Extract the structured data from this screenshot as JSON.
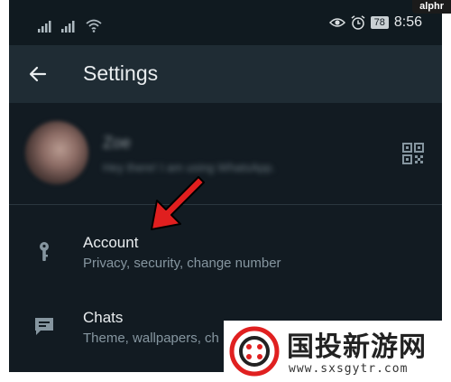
{
  "status_bar": {
    "time": "8:56",
    "battery": "78"
  },
  "app_bar": {
    "title": "Settings"
  },
  "profile": {
    "name": "Zoe",
    "status": "Hey there! I am using WhatsApp."
  },
  "settings_items": [
    {
      "label": "Account",
      "subtitle": "Privacy, security, change number",
      "icon": "key-icon"
    },
    {
      "label": "Chats",
      "subtitle": "Theme, wallpapers, ch",
      "icon": "chat-icon"
    }
  ],
  "watermarks": {
    "corner": "alphr",
    "site_name": "国投新游网",
    "site_url": "www.sxsgytr.com"
  },
  "colors": {
    "background": "#121b22",
    "app_bar": "#1f2c34",
    "arrow": "#e01f1f",
    "text_primary": "#e9edef",
    "text_secondary": "#8696a0"
  }
}
